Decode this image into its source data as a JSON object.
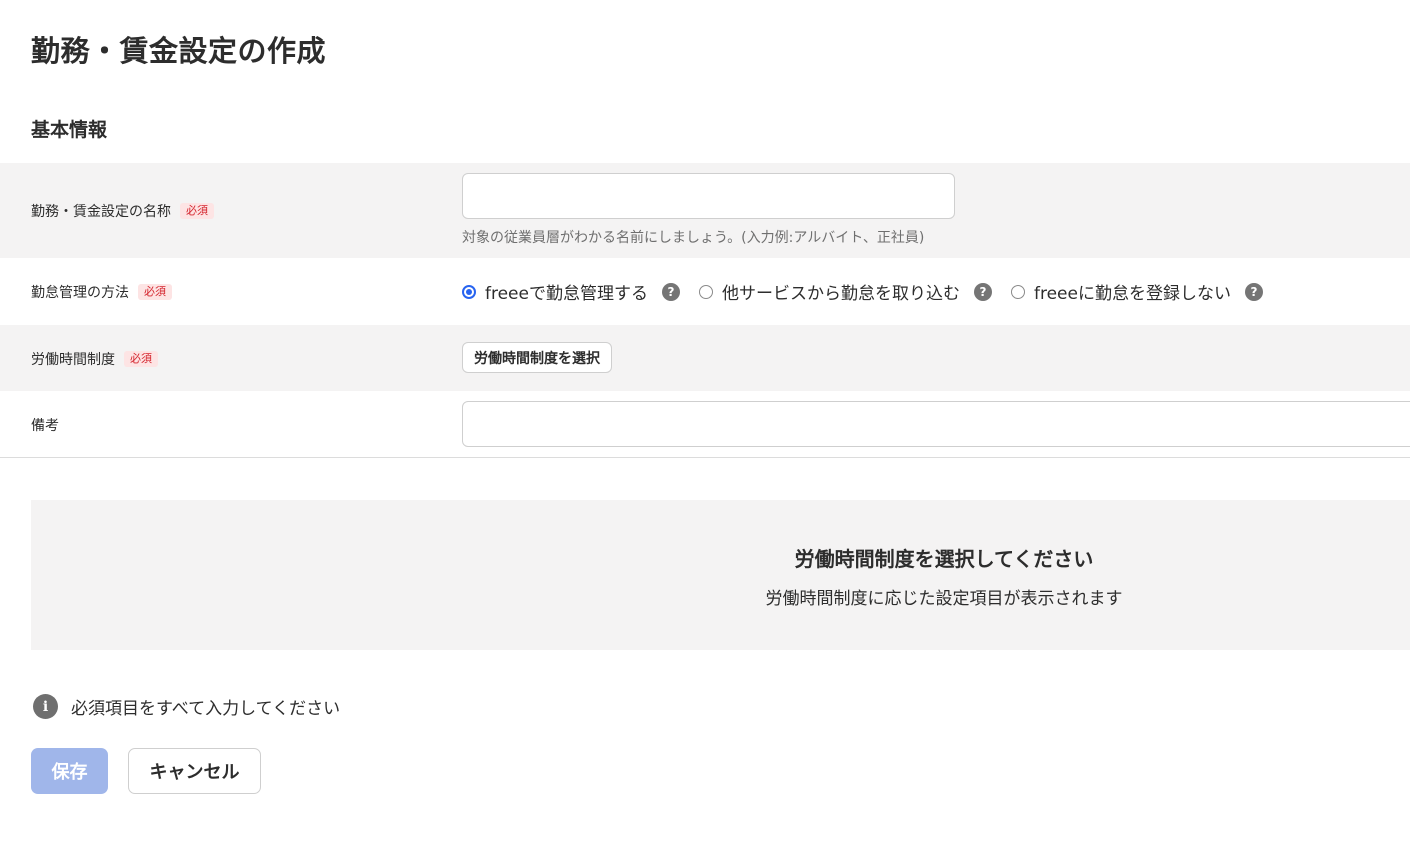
{
  "page": {
    "title": "勤務・賃金設定の作成",
    "section_title": "基本情報"
  },
  "form": {
    "required_badge": "必須",
    "name": {
      "label": "勤務・賃金設定の名称",
      "value": "",
      "help_text": "対象の従業員層がわかる名前にしましょう。(入力例:アルバイト、正社員)"
    },
    "attendance_method": {
      "label": "勤怠管理の方法",
      "options": [
        {
          "label": "freeeで勤怠管理する",
          "checked": true
        },
        {
          "label": "他サービスから勤怠を取り込む",
          "checked": false
        },
        {
          "label": "freeeに勤怠を登録しない",
          "checked": false
        }
      ],
      "help_icon": "?"
    },
    "working_hours_system": {
      "label": "労働時間制度",
      "button_label": "労働時間制度を選択"
    },
    "remarks": {
      "label": "備考",
      "value": ""
    }
  },
  "empty_state": {
    "title": "労働時間制度を選択してください",
    "description": "労働時間制度に応じた設定項目が表示されます"
  },
  "notice": {
    "icon": "i",
    "text": "必須項目をすべて入力してください"
  },
  "actions": {
    "save_label": "保存",
    "cancel_label": "キャンセル"
  },
  "colors": {
    "accent": "#2864f0",
    "required": "#d4242d",
    "save_disabled": "#a0b6ea",
    "row_gray": "#f4f3f3"
  }
}
